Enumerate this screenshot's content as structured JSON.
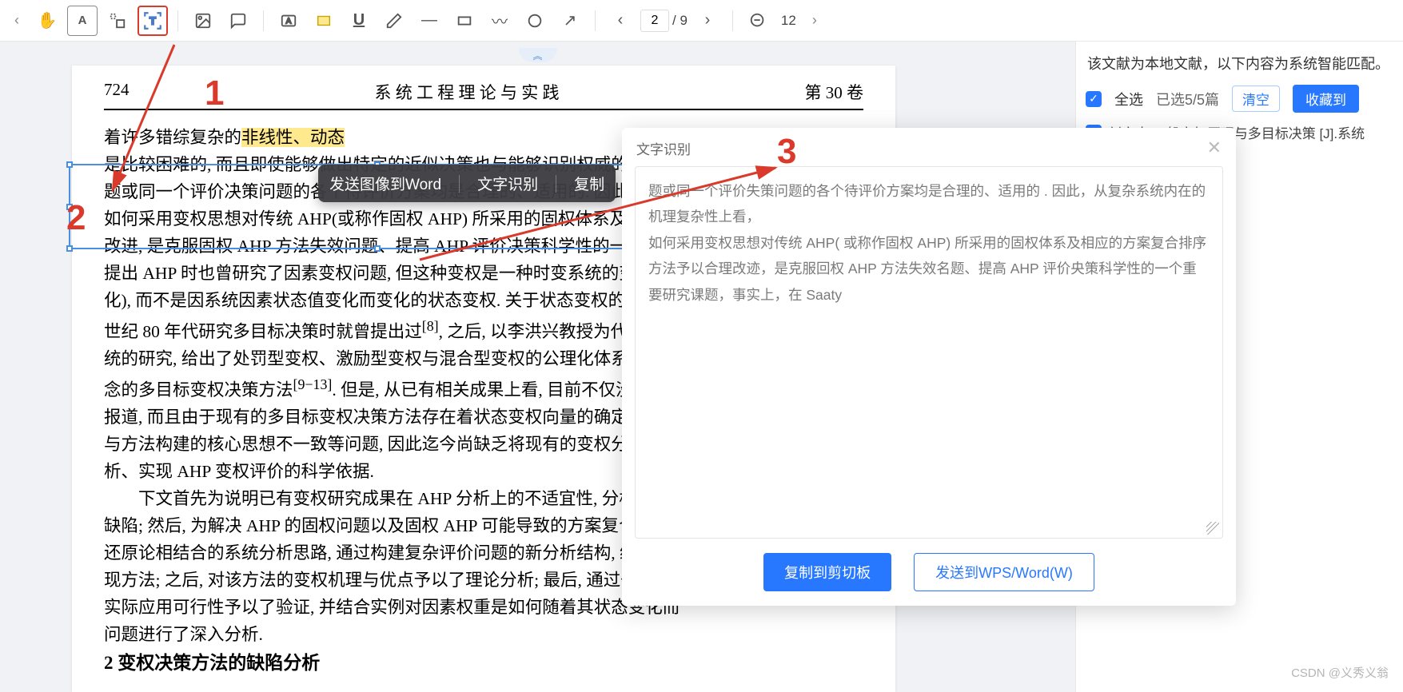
{
  "toolbar": {
    "page_current": "2",
    "page_sep": "/ 9",
    "zoom": "12"
  },
  "pdf": {
    "page_num": "724",
    "journal": "系 统 工 程 理 论 与 实 践",
    "volume": "第   30 卷",
    "lines": {
      "l1a": "着许多错综复杂的",
      "l1b": "非线性、动态",
      "l2": "是比较困难的, 而且即使能够做出特定的近似决策也与能够识别权威的近似决策也是不合",
      "l3": "题或同一个评价决策问题的各个待评价方案均是合理的、适用的. 因此, 从复杂",
      "l4": "如何采用变权思想对传统 AHP(或称作固权 AHP) 所采用的固权体系及相应",
      "l5": "改进, 是克服固权 AHP 方法失效问题、提高 AHP 评价决策科学性的一个重",
      "l6": "提出 AHP 时也曾研究了因素变权问题, 但这种变权是一种时变系统的变权 (",
      "l7": "化), 而不是因系统因素状态值变化而变化的状态变权. 关于状态变权的概念",
      "l8a": "世纪 80 年代研究多目标决策时就曾提出过",
      "l8sup": "[8]",
      "l8b": ", 之后, 以李洪兴教授为代表的",
      "l9": "统的研究, 给出了处罚型变权、激励型变权与混合型变权的公理化体系和基于",
      "l10a": "念的多目标变权决策方法",
      "l10sup": "[9−13]",
      "l10b": ". 但是, 从已有相关成果上看, 目前不仅没有关",
      "l11": "报道, 而且由于现有的多目标变权决策方法存在着状态变权向量的确定过于主",
      "l12": "与方法构建的核心思想不一致等问题, 因此迄今尚缺乏将现有的变权分析方法",
      "l13": "析、实现 AHP 变权评价的科学依据.",
      "p2a": "下文首先为说明已有变权研究成果在 AHP 分析上的不适宜性, 分析了现",
      "p2b": "缺陷; 然后, 为解决 AHP 的固权问题以及固权 AHP 可能导致的方案复合排序",
      "p2c": "还原论相结合的系统分析思路, 通过构建复杂评价问题的新分析结构, 给出了",
      "p2d": "现方法; 之后, 对该方法的变权机理与优点予以了理论分析; 最后, 通过一个实",
      "p2e": "实际应用可行性予以了验证, 并结合实例对因素权重是如何随着其状态变化而",
      "p2f": "问题进行了深入分析.",
      "section": "2   变权决策方法的缺陷分析"
    }
  },
  "ctx": {
    "send_word": "发送图像到Word",
    "ocr": "文字识别",
    "copy": "复制"
  },
  "right": {
    "notice": "该文献为本地文献，以下内容为系统智能匹配。",
    "select_all": "全选",
    "count": "已选5/5篇",
    "clear": "清空",
    "favorite": "收藏到",
    "ref1": "刘文奇.一般变权原理与多目标决策 [J].系统"
  },
  "ocr": {
    "title": "文字识别",
    "p1": "题或同一个评价失策问题的各个待评价方案均是合理的、适用的 . 因此，从复杂系统内在的机理复杂性上看，",
    "p2": "如何采用变权思想对传统 AHP( 或称作固权 AHP) 所采用的固权体系及相应的方案复合排序方法予以合理改迹，是克服回权 AHP 方法失效名题、提高 AHP 评价央策科学性的一个重要研究课题，事实上，在 Saaty",
    "btn_copy": "复制到剪切板",
    "btn_send": "发送到WPS/Word(W)"
  },
  "annotations": {
    "a1": "1",
    "a2": "2",
    "a3": "3"
  },
  "watermark": "CSDN @义秀义翁"
}
